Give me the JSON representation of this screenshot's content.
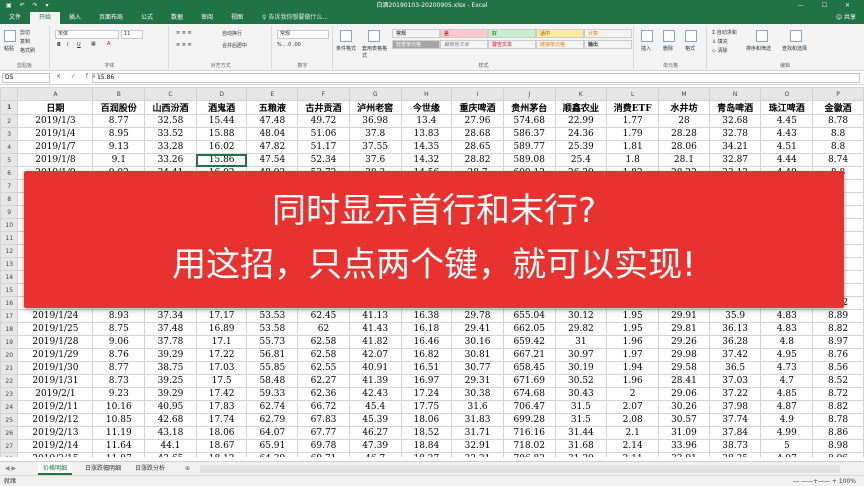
{
  "window": {
    "title": "白酒20190103-20200905.xlsx - Excel",
    "qat": "▣ ↶ ↷ ▾",
    "controls": "— ☐ ✕"
  },
  "ribbon_tabs": [
    "文件",
    "开始",
    "插入",
    "页面布局",
    "公式",
    "数据",
    "审阅",
    "视图"
  ],
  "tell_me": "告诉我你想要做什么...",
  "share": "共享",
  "ribbon": {
    "clipboard": {
      "label": "剪贴板",
      "paste": "粘贴",
      "cut": "剪切",
      "copy": "复制",
      "format_painter": "格式刷"
    },
    "font": {
      "label": "字体",
      "font_name": "宋体",
      "font_size": "11",
      "bold": "B",
      "italic": "I",
      "underline": "U"
    },
    "alignment": {
      "label": "对齐方式",
      "wrap": "自动换行",
      "merge": "合并后居中"
    },
    "number": {
      "label": "数字",
      "format": "常规"
    },
    "styles": {
      "label": "样式",
      "cond_format": "条件格式",
      "table_format": "套用表格格式",
      "cells": [
        {
          "text": "常规",
          "bg": "#ffffff",
          "fg": "#000000"
        },
        {
          "text": "差",
          "bg": "#ffc7ce",
          "fg": "#9c0006"
        },
        {
          "text": "好",
          "bg": "#c6efce",
          "fg": "#006100"
        },
        {
          "text": "适中",
          "bg": "#ffeb9c",
          "fg": "#9c5700"
        },
        {
          "text": "计算",
          "bg": "#f2f2f2",
          "fg": "#fa7d00"
        },
        {
          "text": "检查单元格",
          "bg": "#a5a5a5",
          "fg": "#ffffff"
        },
        {
          "text": "解释性文本",
          "bg": "#ffffff",
          "fg": "#7f7f7f"
        },
        {
          "text": "警告文本",
          "bg": "#ffffff",
          "fg": "#ff0000"
        },
        {
          "text": "链接单元格",
          "bg": "#ffffff",
          "fg": "#fa7d00"
        },
        {
          "text": "输出",
          "bg": "#f2f2f2",
          "fg": "#3f3f3f"
        }
      ]
    },
    "cells": {
      "label": "单元格",
      "insert": "插入",
      "delete": "删除",
      "format": "格式"
    },
    "editing": {
      "label": "编辑",
      "autosum": "自动求和",
      "fill": "填充",
      "clear": "清除",
      "sort": "排序和筛选",
      "find": "查找和选择"
    }
  },
  "formula_bar": {
    "name_box": "D5",
    "icons": "✕ ✓ fx",
    "value": "15.86"
  },
  "columns": [
    "A",
    "B",
    "C",
    "D",
    "E",
    "F",
    "G",
    "H",
    "I",
    "J",
    "K",
    "L",
    "M",
    "N",
    "O",
    "P"
  ],
  "header_row": [
    "日期",
    "百润股份",
    "山西汾酒",
    "酒鬼酒",
    "五粮液",
    "古井贡酒",
    "泸州老窖",
    "今世缘",
    "重庆啤酒",
    "贵州茅台",
    "顺鑫农业",
    "消费ETF",
    "水井坊",
    "青岛啤酒",
    "珠江啤酒",
    "金徽酒"
  ],
  "rows": [
    {
      "n": "2",
      "cells": [
        "2019/1/3",
        "8.77",
        "32.58",
        "15.44",
        "47.48",
        "49.72",
        "36.98",
        "13.4",
        "27.96",
        "574.68",
        "22.99",
        "1.77",
        "28",
        "32.68",
        "4.45",
        "8.78"
      ]
    },
    {
      "n": "3",
      "cells": [
        "2019/1/4",
        "8.95",
        "33.52",
        "15.88",
        "48.04",
        "51.06",
        "37.8",
        "13.83",
        "28.68",
        "586.37",
        "24.36",
        "1.79",
        "28.28",
        "32.78",
        "4.43",
        "8.8"
      ]
    },
    {
      "n": "4",
      "cells": [
        "2019/1/7",
        "9.13",
        "33.28",
        "16.02",
        "47.82",
        "51.17",
        "37.55",
        "14.35",
        "28.65",
        "589.77",
        "25.39",
        "1.81",
        "28.06",
        "34.21",
        "4.51",
        "8.8"
      ]
    },
    {
      "n": "5",
      "cells": [
        "2019/1/8",
        "9.1",
        "33.26",
        "15.86",
        "47.54",
        "52.34",
        "37.6",
        "14.32",
        "28.82",
        "589.08",
        "25.4",
        "1.8",
        "28.1",
        "32.87",
        "4.44",
        "8.74"
      ]
    },
    {
      "n": "6",
      "cells": [
        "2019/1/9",
        "9.02",
        "34.41",
        "16.02",
        "48.92",
        "53.72",
        "38.3",
        "14.56",
        "28.7",
        "600.12",
        "26.29",
        "1.82",
        "28.22",
        "33.13",
        "4.49",
        "8.8"
      ]
    },
    {
      "n": "7",
      "cells": [
        "",
        "",
        "",
        "",
        "",
        "",
        "",
        "",
        "",
        "",
        "",
        "",
        "",
        "",
        "",
        ""
      ]
    },
    {
      "n": "8",
      "cells": [
        "",
        "",
        "",
        "",
        "",
        "",
        "",
        "",
        "",
        "",
        "",
        "",
        "",
        "",
        "",
        ""
      ]
    },
    {
      "n": "9",
      "cells": [
        "",
        "",
        "",
        "",
        "",
        "",
        "",
        "",
        "",
        "",
        "",
        "",
        "",
        "",
        "",
        ""
      ]
    },
    {
      "n": "10",
      "cells": [
        "",
        "",
        "",
        "",
        "",
        "",
        "",
        "",
        "",
        "",
        "",
        "",
        "",
        "",
        "",
        ""
      ]
    },
    {
      "n": "11",
      "cells": [
        "",
        "",
        "",
        "",
        "",
        "",
        "",
        "",
        "",
        "",
        "",
        "",
        "",
        "",
        "",
        ""
      ]
    },
    {
      "n": "12",
      "cells": [
        "",
        "",
        "",
        "",
        "",
        "",
        "",
        "",
        "",
        "",
        "",
        "",
        "",
        "",
        "",
        ""
      ]
    },
    {
      "n": "13",
      "cells": [
        "",
        "",
        "",
        "",
        "",
        "",
        "",
        "",
        "",
        "",
        "",
        "",
        "",
        "",
        "",
        ""
      ]
    },
    {
      "n": "14",
      "cells": [
        "",
        "",
        "",
        "",
        "",
        "",
        "",
        "",
        "",
        "",
        "",
        "",
        "",
        "",
        "",
        ""
      ]
    },
    {
      "n": "15",
      "cells": [
        "",
        "",
        "",
        "",
        "",
        "",
        "",
        "",
        "",
        "",
        "",
        "",
        "",
        "",
        "",
        ""
      ]
    },
    {
      "n": "16",
      "cells": [
        "2019/1/23",
        "8.86",
        "37.01",
        "17.1",
        "53.96",
        "62.38",
        "41.65",
        "16.27",
        "29.64",
        "660.52",
        "30.48",
        "1.94",
        "29.51",
        "35.87",
        "4.81",
        "8.82"
      ]
    },
    {
      "n": "17",
      "cells": [
        "2019/1/24",
        "8.93",
        "37.34",
        "17.17",
        "53.53",
        "62.45",
        "41.13",
        "16.38",
        "29.78",
        "655.04",
        "30.12",
        "1.95",
        "29.91",
        "35.9",
        "4.83",
        "8.89"
      ]
    },
    {
      "n": "18",
      "cells": [
        "2019/1/25",
        "8.75",
        "37.48",
        "16.89",
        "53.58",
        "62",
        "41.43",
        "16.18",
        "29.41",
        "662.05",
        "29.82",
        "1.95",
        "29.81",
        "36.13",
        "4.83",
        "8.82"
      ]
    },
    {
      "n": "19",
      "cells": [
        "2019/1/28",
        "9.06",
        "37.78",
        "17.1",
        "55.73",
        "62.58",
        "41.82",
        "16.46",
        "30.16",
        "659.42",
        "31",
        "1.96",
        "29.26",
        "36.28",
        "4.8",
        "8.97"
      ]
    },
    {
      "n": "20",
      "cells": [
        "2019/1/29",
        "8.76",
        "39.29",
        "17.22",
        "56.81",
        "62.58",
        "42.07",
        "16.82",
        "30.81",
        "667.21",
        "30.97",
        "1.97",
        "29.98",
        "37.42",
        "4.95",
        "8.76"
      ]
    },
    {
      "n": "21",
      "cells": [
        "2019/1/30",
        "8.77",
        "38.75",
        "17.03",
        "55.85",
        "62.55",
        "40.91",
        "16.51",
        "30.77",
        "658.45",
        "30.19",
        "1.94",
        "29.58",
        "36.5",
        "4.73",
        "8.56"
      ]
    },
    {
      "n": "22",
      "cells": [
        "2019/1/31",
        "8.73",
        "39.25",
        "17.5",
        "58.48",
        "62.27",
        "41.39",
        "16.97",
        "29.31",
        "671.69",
        "30.52",
        "1.96",
        "28.41",
        "37.03",
        "4.7",
        "8.52"
      ]
    },
    {
      "n": "23",
      "cells": [
        "2019/2/1",
        "9.23",
        "39.29",
        "17.42",
        "59.33",
        "62.36",
        "42.43",
        "17.24",
        "30.38",
        "674.68",
        "30.43",
        "2",
        "29.06",
        "37.22",
        "4.85",
        "8.72"
      ]
    },
    {
      "n": "24",
      "cells": [
        "2019/2/11",
        "10.16",
        "40.95",
        "17.83",
        "62.74",
        "66.72",
        "45.4",
        "17.75",
        "31.6",
        "706.47",
        "31.5",
        "2.07",
        "30.26",
        "37.98",
        "4.87",
        "8.82"
      ]
    },
    {
      "n": "25",
      "cells": [
        "2019/2/12",
        "10.85",
        "42.68",
        "17.74",
        "62.79",
        "67.83",
        "45.39",
        "18.06",
        "31.83",
        "699.28",
        "31.5",
        "2.08",
        "30.57",
        "37.74",
        "4.9",
        "8.78"
      ]
    },
    {
      "n": "26",
      "cells": [
        "2019/2/13",
        "11.19",
        "43.18",
        "18.06",
        "64.07",
        "67.77",
        "46.27",
        "18.52",
        "31.71",
        "716.16",
        "31.44",
        "2.1",
        "31.09",
        "37.84",
        "4.99",
        "8.86"
      ]
    },
    {
      "n": "27",
      "cells": [
        "2019/2/14",
        "11.64",
        "44.1",
        "18.67",
        "65.91",
        "69.78",
        "47.39",
        "18.84",
        "32.91",
        "718.02",
        "31.68",
        "2.14",
        "33.96",
        "38.73",
        "5",
        "8.98"
      ]
    },
    {
      "n": "28",
      "cells": [
        "2019/2/15",
        "11.97",
        "43.65",
        "18.12",
        "64.39",
        "69.71",
        "46.7",
        "18.27",
        "32.21",
        "706.82",
        "31.39",
        "2.11",
        "33.91",
        "38.35",
        "4.97",
        "8.96"
      ]
    }
  ],
  "banner": {
    "line1": "同时显示首行和末行?",
    "line2": "用这招，只点两个键，就可以实现!"
  },
  "sheet_tabs": [
    "价格明细",
    "日涨跌幅明细",
    "日涨跌分析"
  ],
  "status": {
    "text": "就绪",
    "zoom": "— ——+—— +  100%"
  }
}
